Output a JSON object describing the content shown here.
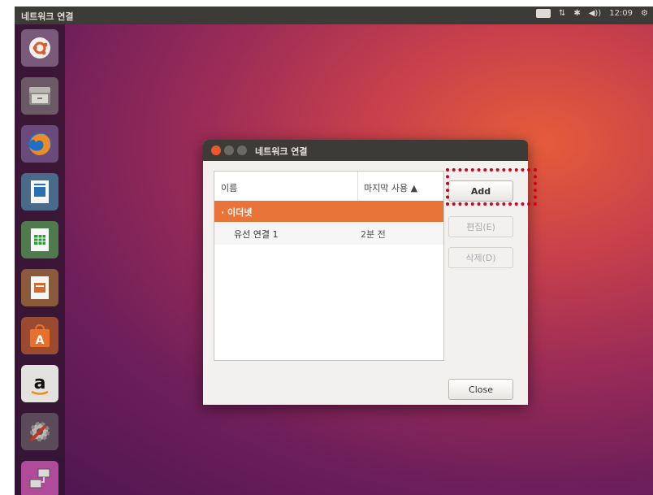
{
  "topbar": {
    "title": "네트워크 연결",
    "time": "12:09",
    "icons": [
      "keyboard-icon",
      "network-updown-icon",
      "bluetooth-icon",
      "volume-icon",
      "power-icon"
    ]
  },
  "launcher": {
    "items": [
      "ubuntu-dash-icon",
      "files-icon",
      "firefox-icon",
      "libreoffice-writer-icon",
      "libreoffice-calc-icon",
      "libreoffice-impress-icon",
      "software-center-icon",
      "amazon-icon",
      "system-settings-icon",
      "network-connections-icon"
    ]
  },
  "dialog": {
    "title": "네트워크 연결",
    "columns": {
      "name": "이름",
      "last_used": "마지막 사용 ▲"
    },
    "group": "· 이더넷",
    "rows": [
      {
        "name": "유선 연결 1",
        "last_used": "2분 전"
      }
    ],
    "buttons": {
      "add": "Add",
      "edit": "편집(E)",
      "delete": "삭제(D)",
      "close": "Close"
    }
  },
  "colors": {
    "accent": "#e9743a",
    "highlight": "#d0021b",
    "panel": "#3c3b37"
  }
}
